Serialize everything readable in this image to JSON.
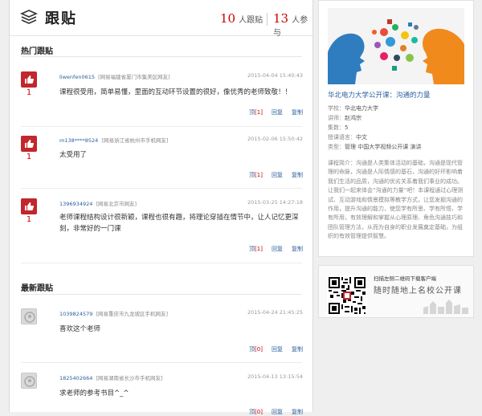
{
  "header": {
    "title": "跟贴",
    "participants_num": "10",
    "participants_label": "人跟贴",
    "joined_num": "13",
    "joined_label": "人参与"
  },
  "hot": {
    "title": "热门跟贴",
    "items": [
      {
        "likes": "1",
        "user": "liwenfen0615",
        "location": "[网易福建省厦门市集美区网友]",
        "time": "2015-04-04 15:40:43",
        "content": "课程很受用，简单易懂，里面的互动环节设置的很好，像优秀的老师致敬！！",
        "up": "顶",
        "up_count": "[1]",
        "reply": "回复",
        "copy": "复制"
      },
      {
        "likes": "1",
        "user": "m138****8524",
        "location": "[网易浙江省杭州市手机网友]",
        "time": "2015-02-06 15:50:42",
        "content": "太受用了",
        "up": "顶",
        "up_count": "[1]",
        "reply": "回复",
        "copy": "复制"
      },
      {
        "likes": "1",
        "user": "1396934924",
        "location": "[网易北京市网友]",
        "time": "2015-03-25 14:27:18",
        "content": "老师课程结构设计很新颖，课程也很有趣，将理论穿插在情节中，让人记忆更深刻，非常好的一门课",
        "up": "顶",
        "up_count": "[1]",
        "reply": "回复",
        "copy": "复制"
      }
    ]
  },
  "latest": {
    "title": "最新跟贴",
    "items": [
      {
        "user": "1039824579",
        "location": "[网易重庆市九龙坡区手机网友]",
        "time": "2015-04-24 21:45:25",
        "content": "喜欢这个老师",
        "up": "顶",
        "up_count": "[0]",
        "reply": "回复",
        "copy": "复制"
      },
      {
        "user": "1825402664",
        "location": "[网易湖南省长沙市手机网友]",
        "time": "2015-04-13 13:15:54",
        "content": "求老师的参考书目^_^",
        "up": "顶",
        "up_count": "[0]",
        "reply": "回复",
        "copy": "复制"
      }
    ]
  },
  "course": {
    "title": "华北电力大学公开课：沟通的力量",
    "school_label": "学校：",
    "school": "华北电力大学",
    "teacher_label": "讲师：",
    "teacher": "赵鸿宗",
    "episodes_label": "集数：",
    "episodes": "5",
    "language_label": "授课语言：",
    "language": "中文",
    "category_label": "类型：",
    "category": "管理 中国大学视频公开课 演讲",
    "desc": "课程简介：沟通是人类集体活动的基础，沟通是现代管理的命脉，沟通是人际情感的基石，沟通的好坏影响着我们生活的品质，沟通的优劣关系着我们事业的成功。让我们一起来体会“沟通的力量”吧！本课程通过心理测试、互动游戏和情景模拟等教学方式，让您发掘沟通的作用，提升沟通的能力，使您学有所思、学有所悟、学有所用，有效理解和掌握从心理原理、角色沟通技巧和团队管理方法，从而为自身的职业发展奠定基础，为组织的有效管理提供智慧。"
  },
  "app": {
    "qr_text": "扫描左侧二维码下载客户端",
    "slogan": "随时随地上名校公开课"
  },
  "colors": {
    "accent": "#c1272d",
    "link": "#2a5f9e"
  }
}
